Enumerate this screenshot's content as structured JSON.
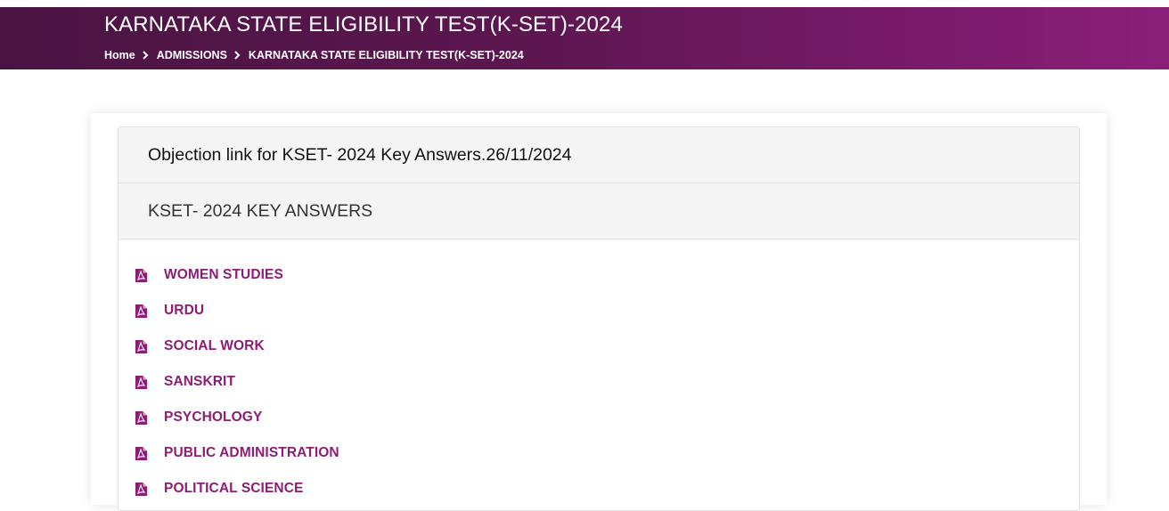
{
  "header": {
    "title": "KARNATAKA STATE ELIGIBILITY TEST(K-SET)-2024",
    "breadcrumb": [
      "Home",
      "ADMISSIONS",
      "KARNATAKA STATE ELIGIBILITY TEST(K-SET)-2024"
    ]
  },
  "panel": {
    "notice_link": "Objection link for KSET- 2024 Key Answers.26/11/2024",
    "section_heading": "KSET- 2024 KEY ANSWERS",
    "files": [
      {
        "label": "WOMEN STUDIES",
        "icon": "pdf-icon"
      },
      {
        "label": "URDU",
        "icon": "pdf-icon"
      },
      {
        "label": "SOCIAL WORK",
        "icon": "pdf-icon"
      },
      {
        "label": "SANSKRIT",
        "icon": "pdf-icon"
      },
      {
        "label": "PSYCHOLOGY",
        "icon": "pdf-icon"
      },
      {
        "label": "PUBLIC ADMINISTRATION",
        "icon": "pdf-icon"
      },
      {
        "label": "POLITICAL SCIENCE",
        "icon": "pdf-icon"
      }
    ]
  },
  "colors": {
    "header_start": "#4a1442",
    "header_end": "#8a1f78",
    "link": "#8c1d74",
    "panel_row_bg": "#f5f5f5"
  }
}
